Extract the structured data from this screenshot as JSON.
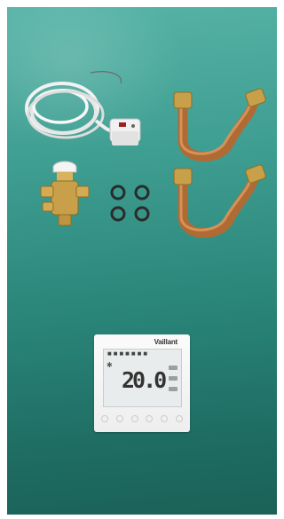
{
  "image": {
    "subject": "heating kit components",
    "colors": {
      "background_top": "#56b3a6",
      "background_bottom": "#1b6158",
      "copper": "#c07a45",
      "brass": "#c9a04a"
    }
  },
  "thermostat": {
    "brand": "Vaillant",
    "temperature": "20.0",
    "mode_icon": "sun-icon"
  }
}
